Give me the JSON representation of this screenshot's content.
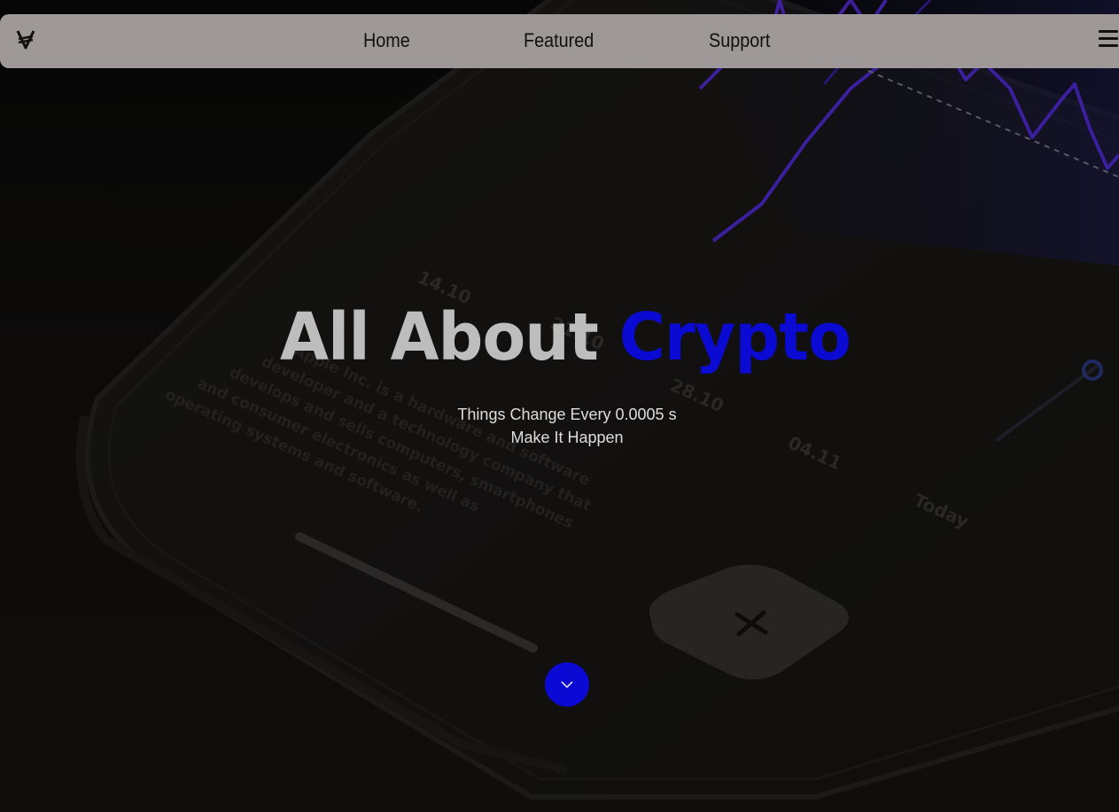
{
  "nav": {
    "logo_icon": "vite-coin-logo-icon",
    "links": [
      {
        "label": "Home"
      },
      {
        "label": "Featured"
      },
      {
        "label": "Support"
      }
    ],
    "menu_icon": "hamburger-menu-icon"
  },
  "hero": {
    "title_part1": "All About ",
    "title_part2": "Crypto",
    "subtitle_line1": "Things Change Every 0.0005 s",
    "subtitle_line2": "Make It Happen",
    "scroll_icon": "chevron-down-icon"
  },
  "background": {
    "image": "smartphone-crypto-chart-artwork",
    "phone_text": [
      "Apple Inc. is a hardware and software",
      "developer and a technology company that",
      "develops and sells computers, smartphones",
      "and consumer electronics as well as",
      "operating systems and software."
    ],
    "dates": [
      "14.10",
      "21.10",
      "28.10",
      "04.11",
      "Today"
    ]
  },
  "colors": {
    "accent_blue": "#0a0ad2",
    "navbar_bg": "#9e9898",
    "page_bg": "#0b0a09",
    "chart_line": "#4a22b8"
  }
}
